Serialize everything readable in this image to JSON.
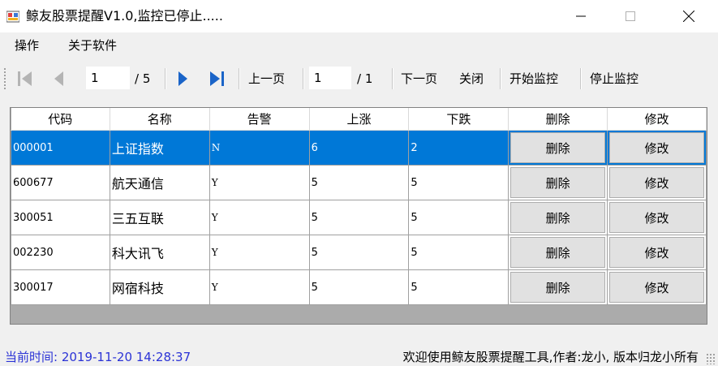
{
  "window": {
    "title": "鲸友股票提醒V1.0,监控已停止....."
  },
  "menu": {
    "items": [
      {
        "label": "操作"
      },
      {
        "label": "关于软件"
      }
    ]
  },
  "toolbar": {
    "current_page": "1",
    "total_pages": "/ 5",
    "prev_page_label": "上一页",
    "sub_page": "1",
    "sub_total": "/ 1",
    "next_page_label": "下一页",
    "close_label": "关闭",
    "start_label": "开始监控",
    "stop_label": "停止监控"
  },
  "table": {
    "columns": [
      "代码",
      "名称",
      "告警",
      "上涨",
      "下跌",
      "删除",
      "修改"
    ],
    "rows": [
      {
        "code": "000001",
        "name": "上证指数",
        "alert": "N",
        "up": "6",
        "down": "2",
        "delete": "删除",
        "edit": "修改"
      },
      {
        "code": "600677",
        "name": "航天通信",
        "alert": "Y",
        "up": "5",
        "down": "5",
        "delete": "删除",
        "edit": "修改"
      },
      {
        "code": "300051",
        "name": "三五互联",
        "alert": "Y",
        "up": "5",
        "down": "5",
        "delete": "删除",
        "edit": "修改"
      },
      {
        "code": "002230",
        "name": "科大讯飞",
        "alert": "Y",
        "up": "5",
        "down": "5",
        "delete": "删除",
        "edit": "修改"
      },
      {
        "code": "300017",
        "name": "网宿科技",
        "alert": "Y",
        "up": "5",
        "down": "5",
        "delete": "删除",
        "edit": "修改"
      }
    ]
  },
  "status": {
    "time": "当前时间:  2019-11-20 14:28:37",
    "message": "欢迎使用鲸友股票提醒工具,作者:龙小,  版本归龙小所有"
  },
  "colors": {
    "selection": "#0078d7",
    "nav_arrow_active": "#1a64c8",
    "status_time": "#2b33d6"
  }
}
